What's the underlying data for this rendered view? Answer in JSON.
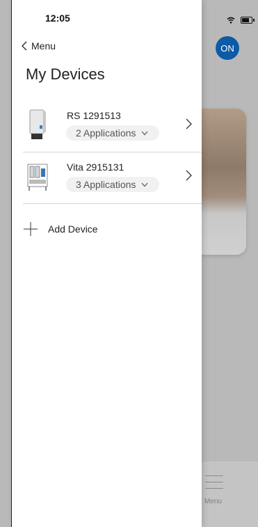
{
  "status_bar": {
    "time": "12:05"
  },
  "drawer": {
    "back_label": "Menu",
    "title": "My Devices",
    "devices": [
      {
        "name": "RS 1291513",
        "applications": "2 Applications",
        "icon": "water-softener-device"
      },
      {
        "name": "Vita 2915131",
        "applications": "3 Applications",
        "icon": "filtration-rack-device"
      }
    ],
    "add_label": "Add Device"
  },
  "background": {
    "badge": "ON",
    "bottom_menu_label": "Menu"
  },
  "colors": {
    "badge_blue": "#0d5aa7",
    "overlay_grey": "#b9b9b9",
    "pill_bg": "#f1f1f1"
  }
}
